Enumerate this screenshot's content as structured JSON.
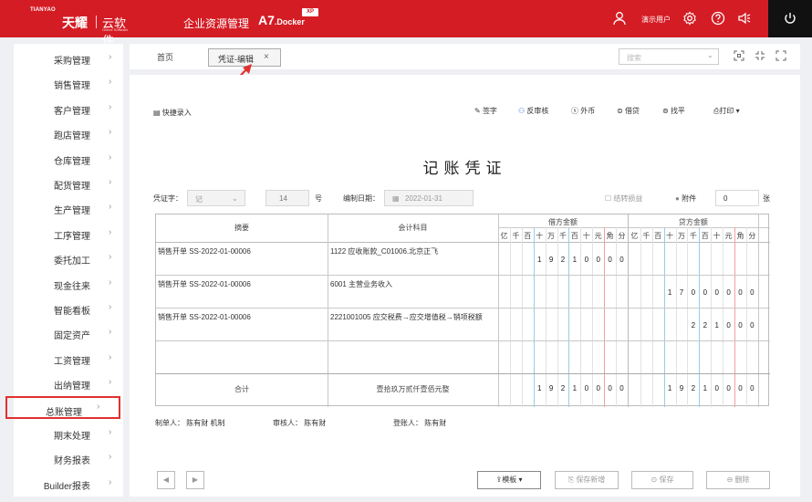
{
  "header": {
    "brand_small": "TIANYAO",
    "brand_cn": "天耀",
    "product": "云软件",
    "product_sub": "Online Software",
    "system_name": "企业资源管理",
    "version_main": "A7",
    "version_sub": ".Docker",
    "version_badge": "XP",
    "user_name": "演示用户"
  },
  "sidebar": {
    "items": [
      {
        "label": "采购管理"
      },
      {
        "label": "销售管理"
      },
      {
        "label": "客户管理"
      },
      {
        "label": "跑店管理"
      },
      {
        "label": "仓库管理"
      },
      {
        "label": "配货管理"
      },
      {
        "label": "生产管理"
      },
      {
        "label": "工序管理"
      },
      {
        "label": "委托加工"
      },
      {
        "label": "现金往来"
      },
      {
        "label": "智能看板"
      },
      {
        "label": "固定资产"
      },
      {
        "label": "工资管理"
      },
      {
        "label": "出纳管理"
      },
      {
        "label": "总账管理"
      },
      {
        "label": "期末处理"
      },
      {
        "label": "财务报表"
      },
      {
        "label": "Builder报表"
      }
    ],
    "active_index": 14
  },
  "tabs": {
    "home": "首页",
    "active": "凭证-编辑",
    "close": "×",
    "search_placeholder": "搜索"
  },
  "toolbar": {
    "quick_entry": "快捷录入",
    "sign": "签字",
    "unaudit": "反审核",
    "foreign": "外币",
    "borrow": "借贷",
    "balance": "找平",
    "print": "打印"
  },
  "voucher": {
    "title": "记账凭证",
    "word_label": "凭证字：",
    "word_value": "记",
    "number_value": "14",
    "number_suffix": "号",
    "date_label": "编制日期：",
    "date_value": "2022-01-31",
    "carry_label": "结转损益",
    "attach_label": "附件",
    "attach_value": "0",
    "attach_unit": "张",
    "headers": {
      "summary": "摘要",
      "account": "会计科目",
      "debit": "借方金额",
      "credit": "贷方金额",
      "units": [
        "亿",
        "千",
        "百",
        "十",
        "万",
        "千",
        "百",
        "十",
        "元",
        "角",
        "分"
      ]
    },
    "rows": [
      {
        "summary": "销售开单 SS-2022-01-00006",
        "account": "1122 应收账款_C01006.北京正飞",
        "debit": [
          "",
          "",
          "",
          "1",
          "9",
          "2",
          "1",
          "0",
          "0",
          "0",
          "0"
        ],
        "credit": [
          "",
          "",
          "",
          "",
          "",
          "",
          "",
          "",
          "",
          "",
          ""
        ]
      },
      {
        "summary": "销售开单 SS-2022-01-00006",
        "account": "6001 主营业务收入",
        "debit": [
          "",
          "",
          "",
          "",
          "",
          "",
          "",
          "",
          "",
          "",
          ""
        ],
        "credit": [
          "",
          "",
          "",
          "1",
          "7",
          "0",
          "0",
          "0",
          "0",
          "0",
          "0"
        ]
      },
      {
        "summary": "销售开单 SS-2022-01-00006",
        "account": "2221001005 应交税费→应交增值税→销项税额",
        "debit": [
          "",
          "",
          "",
          "",
          "",
          "",
          "",
          "",
          "",
          "",
          ""
        ],
        "credit": [
          "",
          "",
          "",
          "",
          "",
          "2",
          "2",
          "1",
          "0",
          "0",
          "0"
        ]
      },
      {
        "summary": "",
        "account": "",
        "debit": [
          "",
          "",
          "",
          "",
          "",
          "",
          "",
          "",
          "",
          "",
          ""
        ],
        "credit": [
          "",
          "",
          "",
          "",
          "",
          "",
          "",
          "",
          "",
          "",
          ""
        ]
      }
    ],
    "total": {
      "label": "合计",
      "amount_words": "壹拾玖万贰仟壹佰元整",
      "debit": [
        "",
        "",
        "",
        "1",
        "9",
        "2",
        "1",
        "0",
        "0",
        "0",
        "0"
      ],
      "credit": [
        "",
        "",
        "",
        "1",
        "9",
        "2",
        "1",
        "0",
        "0",
        "0",
        "0"
      ]
    },
    "signers": {
      "maker_label": "制单人：",
      "maker": "陈有财 机制",
      "auditor_label": "审核人：",
      "auditor": "陈有财",
      "poster_label": "登账人：",
      "poster": "陈有财"
    }
  },
  "bottom": {
    "prev": "◀",
    "next": "▶",
    "template": "模板",
    "save_new": "保存新增",
    "save": "保存",
    "delete": "删除"
  },
  "colors": {
    "brand": "#d41c24",
    "highlight": "#e0312f"
  }
}
